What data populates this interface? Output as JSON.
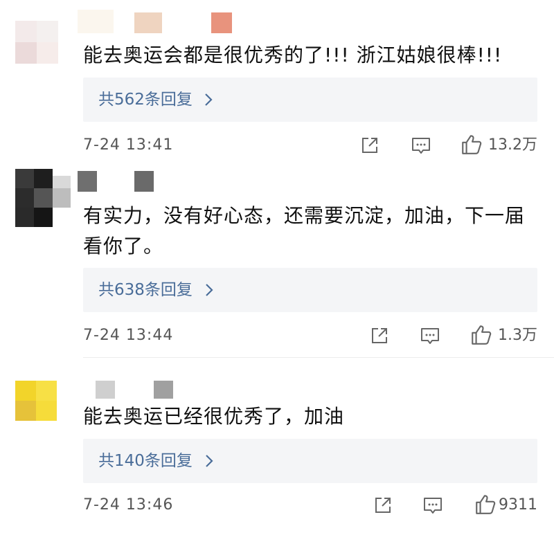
{
  "comments": [
    {
      "text": "能去奥运会都是很优秀的了!!! 浙江姑娘很棒!!!",
      "replies": "共562条回复",
      "time": "7-24 13:41",
      "likes": "13.2万"
    },
    {
      "text": "有实力，没有好心态，还需要沉淀，加油，下一届看你了。",
      "replies": "共638条回复",
      "time": "7-24 13:44",
      "likes": "1.3万"
    },
    {
      "text": "能去奥运已经很优秀了，加油",
      "replies": "共140条回复",
      "time": "7-24 13:46",
      "likes": "9311"
    }
  ],
  "icons": {
    "share": "share-icon",
    "comment": "comment-icon",
    "like": "thumbs-up-icon",
    "chevron": "chevron-right-icon"
  },
  "colors": {
    "reply_link": "#4a6d99",
    "reply_bg": "#f4f5f7",
    "meta_text": "#555555"
  }
}
